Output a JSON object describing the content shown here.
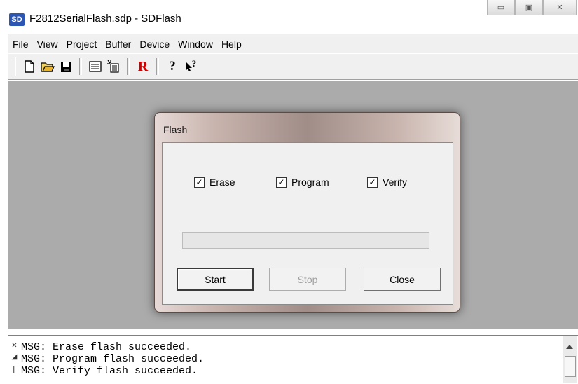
{
  "window": {
    "title": "F2812SerialFlash.sdp - SDFlash",
    "app_icon_text": "SD",
    "buttons": {
      "minimize": "▭",
      "maximize": "▣",
      "close": "✕"
    }
  },
  "menubar": {
    "items": [
      {
        "label": "File"
      },
      {
        "label": "View"
      },
      {
        "label": "Project"
      },
      {
        "label": "Buffer"
      },
      {
        "label": "Device"
      },
      {
        "label": "Window"
      },
      {
        "label": "Help"
      }
    ]
  },
  "toolbar": {
    "icons": [
      "new-file-icon",
      "open-folder-icon",
      "save-icon",
      "list-icon",
      "flash-icon",
      "reset-icon",
      "help-icon",
      "context-help-icon"
    ],
    "reset_label": "R",
    "help_label": "?",
    "context_help_label": "?"
  },
  "dialog": {
    "title": "Flash",
    "checkboxes": [
      {
        "label": "Erase",
        "checked": true
      },
      {
        "label": "Program",
        "checked": true
      },
      {
        "label": "Verify",
        "checked": true
      }
    ],
    "progress": 0,
    "buttons": {
      "start": "Start",
      "stop": "Stop",
      "close": "Close"
    },
    "check_mark": "✓"
  },
  "log": {
    "lines": [
      "MSG: Erase flash succeeded.",
      "MSG: Program flash succeeded.",
      "MSG: Verify flash succeeded."
    ]
  }
}
